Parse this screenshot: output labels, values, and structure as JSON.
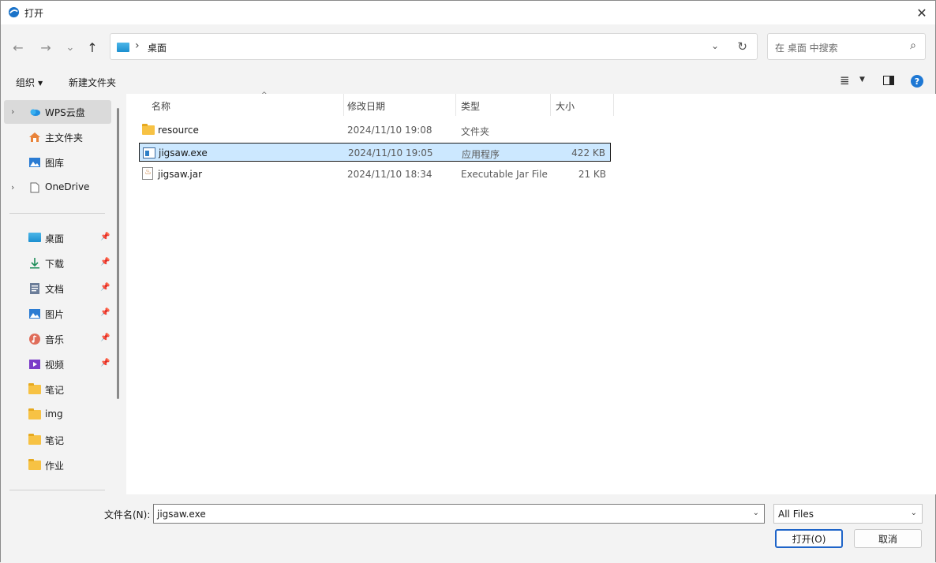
{
  "window": {
    "title": "打开",
    "close": "✕"
  },
  "nav": {
    "back": "←",
    "forward": "→",
    "recent": "⌄",
    "up": "↑",
    "breadcrumb_sep": "›",
    "path": "桌面",
    "dropdown": "⌄",
    "refresh": "↻"
  },
  "search": {
    "placeholder": "在 桌面 中搜索",
    "icon": "⌕"
  },
  "toolbar": {
    "organize": "组织",
    "organize_caret": "▼",
    "new_folder": "新建文件夹",
    "view_icon": "≣",
    "view_caret": "▼",
    "help": "?"
  },
  "sidebar": {
    "top": [
      {
        "label": "WPS云盘",
        "expand": "›",
        "icon": "cloud-icon"
      },
      {
        "label": "主文件夹",
        "icon": "home-icon"
      },
      {
        "label": "图库",
        "icon": "gallery-icon"
      },
      {
        "label": "OneDrive",
        "expand": "›",
        "icon": "onedrive-icon"
      }
    ],
    "quick": [
      {
        "label": "桌面",
        "pinned": true
      },
      {
        "label": "下载",
        "pinned": true
      },
      {
        "label": "文档",
        "pinned": true
      },
      {
        "label": "图片",
        "pinned": true
      },
      {
        "label": "音乐",
        "pinned": true
      },
      {
        "label": "视频",
        "pinned": true
      },
      {
        "label": "笔记"
      },
      {
        "label": "img"
      },
      {
        "label": "笔记"
      },
      {
        "label": "作业"
      }
    ],
    "pin_glyph": "📌"
  },
  "columns": {
    "name": "名称",
    "date": "修改日期",
    "type": "类型",
    "size": "大小",
    "sort_caret": "^"
  },
  "files": [
    {
      "name": "resource",
      "date": "2024/11/10 19:08",
      "type": "文件夹",
      "size": "",
      "icon": "folder-icon"
    },
    {
      "name": "jigsaw.exe",
      "date": "2024/11/10 19:05",
      "type": "应用程序",
      "size": "422 KB",
      "icon": "exe-icon",
      "selected": true
    },
    {
      "name": "jigsaw.jar",
      "date": "2024/11/10 18:34",
      "type": "Executable Jar File",
      "size": "21 KB",
      "icon": "jar-icon"
    }
  ],
  "footer": {
    "filename_label": "文件名(N):",
    "filename_value": "jigsaw.exe",
    "filetype_value": "All Files",
    "dropdown": "⌄",
    "open_button": "打开(O)",
    "cancel_button": "取消"
  }
}
